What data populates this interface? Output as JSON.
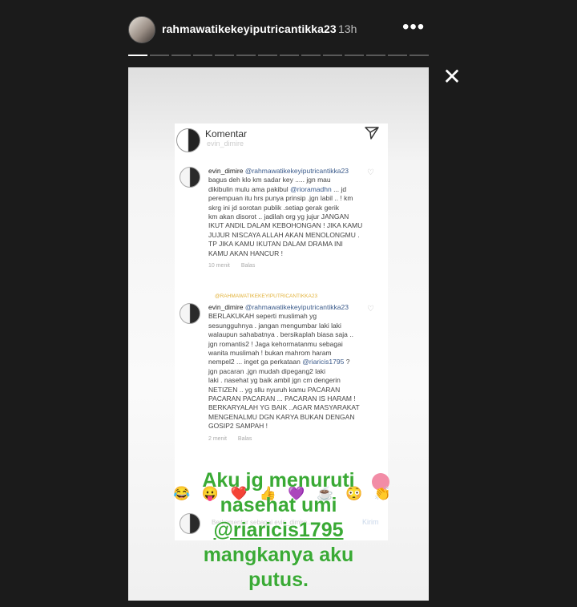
{
  "header": {
    "username": "rahmawatikekeyiputricantikka23",
    "time_ago": "13h",
    "more_label": "•••",
    "close_label": "✕"
  },
  "progress": {
    "segments": 14,
    "active_index": 0
  },
  "screenshot": {
    "title": "Komentar",
    "subtitle": "evin_dimire",
    "comments": [
      {
        "user": "evin_dimire",
        "mention": "@rahmawatikekeyiputricantikka23",
        "text_lines": [
          "bagus deh klo km sadar key ..... jgn mau",
          "dikibulin mulu ama pakibul",
          "perempuan itu hrs punya prinsip .jgn labil .. ! km",
          "skrg ini jd sorotan publik .setiap gerak gerik",
          "km akan disorot .. jadilah org yg jujur JANGAN",
          "IKUT ANDIL DALAM KEBOHONGAN ! JIKA KAMU",
          "JUJUR NISCAYA ALLAH AKAN MENOLONGMU .",
          "TP JIKA KAMU IKUTAN DALAM DRAMA INI",
          "KAMU AKAN HANCUR !"
        ],
        "inline_mention": "@rioramadhn",
        "inline_tail": "... jd",
        "time": "10 menit",
        "reply": "Balas"
      },
      {
        "user": "evin_dimire",
        "mention": "@rahmawatikekeyiputricantikka23",
        "text_lines": [
          "BERLAKUKAH seperti muslimah yg",
          "sesungguhnya . jangan mengumbar laki laki",
          "walaupun sahabatnya . bersikaplah biasa saja ..",
          "jgn romantis2 ! Jaga kehormatanmu sebagai",
          "wanita muslimah ! bukan mahrom haram",
          "nempel2 ... inget ga perkataan",
          "jgn pacaran .jgn mudah dipegang2 laki",
          "laki .  nasehat yg baik ambil jgn cm dengerin",
          "NETIZEN .. yg sllu nyuruh kamu PACARAN",
          "PACARAN PACARAN ... PACARAN IS HARAM !",
          "BERKARYALAH YG BAIK ..AGAR MASYARAKAT",
          "MENGENALMU DGN KARYA BUKAN DENGAN",
          "GOSIP2 SAMPAH !"
        ],
        "inline_mention": "@riaricis1795",
        "inline_tail": "?",
        "time": "2 menit",
        "reply": "Balas"
      }
    ],
    "reply_chip": "@RAHMAWATIKEKEYIPUTRICANTIKKA23",
    "emojis": [
      "😂",
      "😛",
      "❤️",
      "👍",
      "💜",
      "☕",
      "😳",
      "👏"
    ],
    "input_placeholder": "Berkomentar sebagai evin_dimire...",
    "send_label": "Kirim"
  },
  "overlay_text": {
    "line1": "Aku jg menuruti",
    "line2": "nasehat umi",
    "line3": "@riaricis1795",
    "line4": "mangkanya aku",
    "line5": "putus."
  },
  "colors": {
    "background": "#1b1b1b",
    "overlay_text": "#3aaa35",
    "mention": "#3a5a8a"
  }
}
